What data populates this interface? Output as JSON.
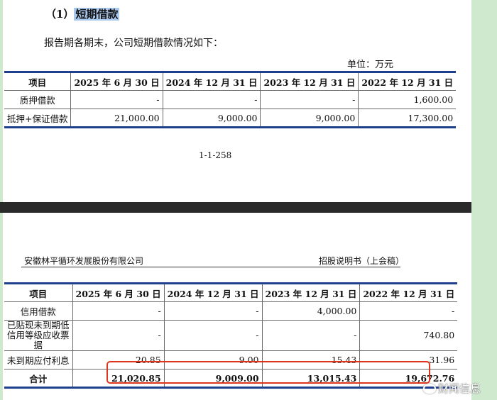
{
  "section_title": {
    "number": "（1）",
    "text": "短期借款"
  },
  "intro": "报告期各期末，公司短期借款情况如下：",
  "unit": "单位：万元",
  "table1": {
    "headers": [
      "项目",
      "2025 年 6 月 30 日",
      "2024 年 12 月 31 日",
      "2023 年 12 月 31 日",
      "2022 年 12 月 31 日"
    ],
    "rows": [
      [
        "质押借款",
        "-",
        "-",
        "-",
        "1,600.00"
      ],
      [
        "抵押+保证借款",
        "21,000.00",
        "9,000.00",
        "9,000.00",
        "17,300.00"
      ]
    ]
  },
  "page_number": "1-1-258",
  "company": "安徽林平循环发展股份有限公司",
  "doc_name": "招股说明书（上会稿）",
  "table2": {
    "headers": [
      "项目",
      "2025 年 6 月 30 日",
      "2024 年 12 月 31 日",
      "2023 年 12 月 31 日",
      "2022 年 12 月 31 日"
    ],
    "rows": [
      [
        "信用借款",
        "-",
        "-",
        "4,000.00",
        "-"
      ],
      [
        "已贴现未到期低信用等级应收票据",
        "-",
        "-",
        "-",
        "740.80"
      ],
      [
        "未到期应付利息",
        "20.85",
        "9.00",
        "15.43",
        "31.96"
      ],
      [
        "合计",
        "21,020.85",
        "9,009.00",
        "13,015.43",
        "19,672.76"
      ]
    ]
  },
  "watermark": "财闻信息",
  "colors": {
    "rule": "#1e3f8c",
    "highlight_box": "#e0351d",
    "background": "#cfe9cf"
  }
}
